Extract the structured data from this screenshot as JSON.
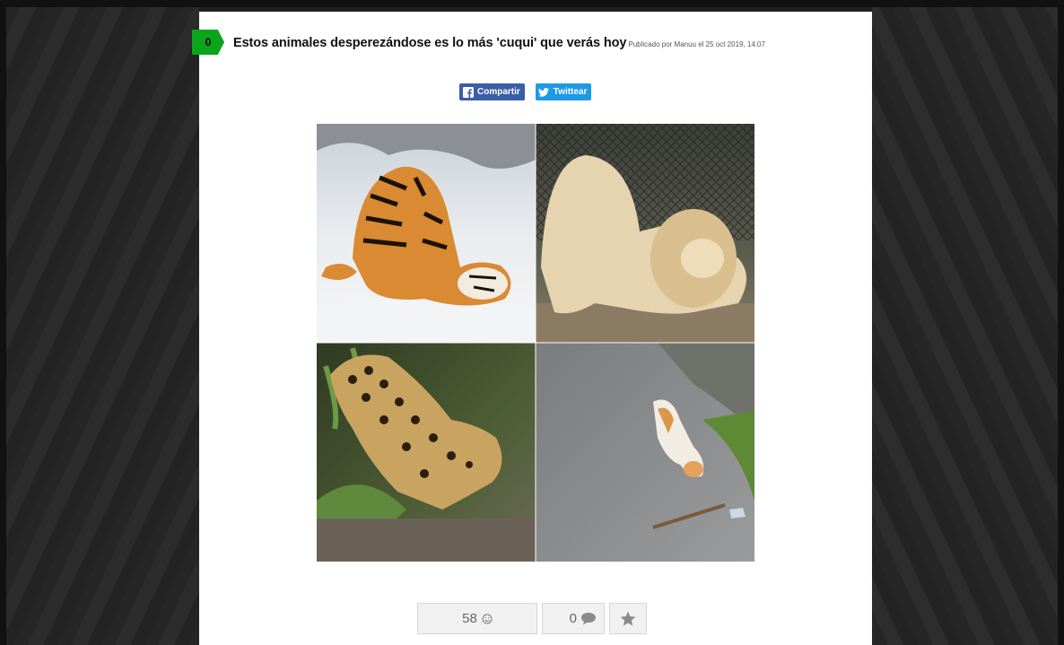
{
  "post": {
    "score": "0",
    "title": "Estos animales desperezándose es lo más 'cuqui' que verás hoy",
    "meta": "Publicado por Manuu el 25 oct 2019, 14:07"
  },
  "share": {
    "facebook_label": "Compartir",
    "twitter_label": "Twittear",
    "facebook_color": "#3b5ea8",
    "twitter_color": "#1c9ae6"
  },
  "image": {
    "panels": [
      "tiger-stretching",
      "lion-stretching",
      "jaguar-stretching",
      "cat-stretching"
    ]
  },
  "actions": {
    "likes": "58",
    "like_icon": "smiley-icon",
    "comments": "0",
    "comment_icon": "speech-bubble-icon",
    "favorite_icon": "star-icon"
  },
  "colors": {
    "score_badge": "#0aa51a",
    "page_bg": "#1f1f1f"
  }
}
